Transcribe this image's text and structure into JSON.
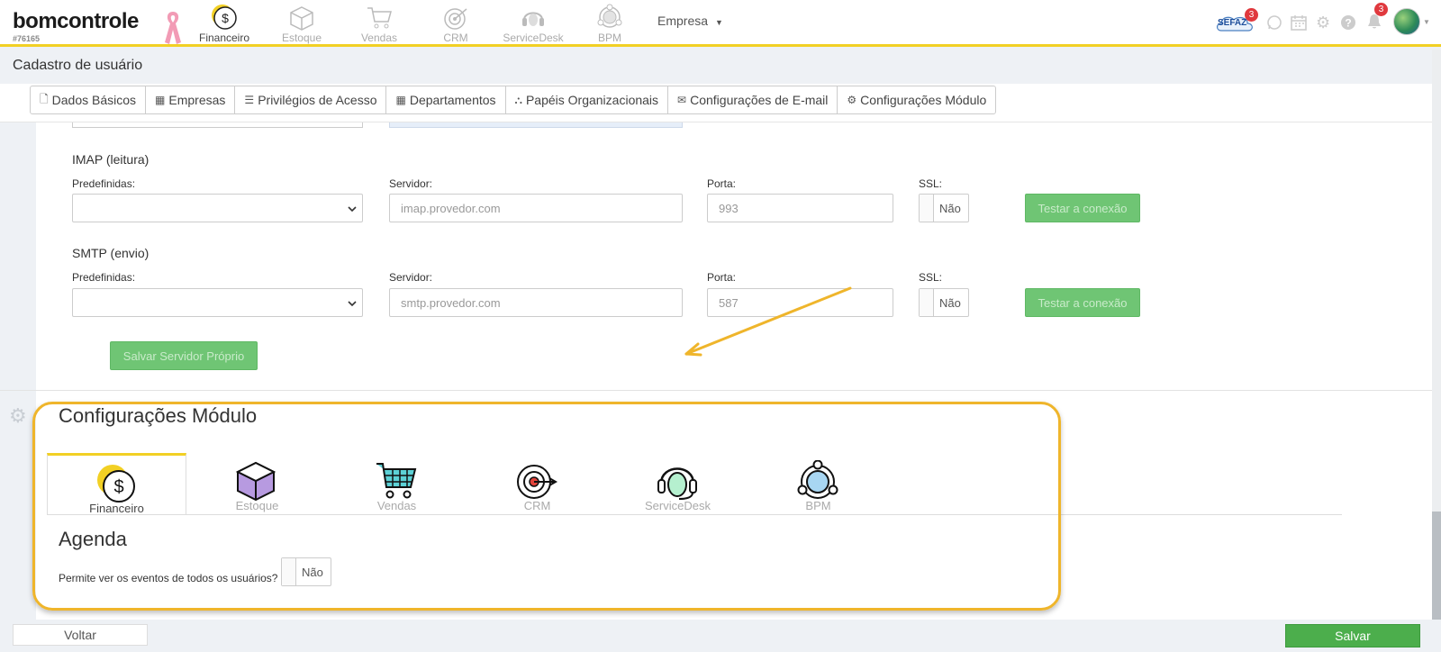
{
  "brand": {
    "name": "bomcontrole",
    "code": "#76165"
  },
  "modules": [
    {
      "label": "Financeiro",
      "icon": "dollar-coin-icon"
    },
    {
      "label": "Estoque",
      "icon": "box-icon"
    },
    {
      "label": "Vendas",
      "icon": "cart-icon"
    },
    {
      "label": "CRM",
      "icon": "target-icon"
    },
    {
      "label": "ServiceDesk",
      "icon": "headset-icon"
    },
    {
      "label": "BPM",
      "icon": "network-icon"
    }
  ],
  "empresa": {
    "label": "Empresa"
  },
  "topRight": {
    "sefaz_label": "SEFAZ",
    "sefaz_badge": "3",
    "bell_badge": "3"
  },
  "page": {
    "title": "Cadastro de usuário"
  },
  "tabs": [
    {
      "label": "Dados Básicos",
      "icon": "file-icon"
    },
    {
      "label": "Empresas",
      "icon": "building-icon"
    },
    {
      "label": "Privilégios de Acesso",
      "icon": "list-icon"
    },
    {
      "label": "Departamentos",
      "icon": "building-icon"
    },
    {
      "label": "Papéis Organizacionais",
      "icon": "sitemap-icon"
    },
    {
      "label": "Configurações de E-mail",
      "icon": "envelope-icon"
    },
    {
      "label": "Configurações Módulo",
      "icon": "gear-icon"
    }
  ],
  "imap": {
    "title": "IMAP (leitura)",
    "predef_label": "Predefinidas:",
    "server_label": "Servidor:",
    "server_placeholder": "imap.provedor.com",
    "port_label": "Porta:",
    "port_placeholder": "993",
    "ssl_label": "SSL:",
    "ssl_value": "Não",
    "test_button": "Testar a conexão"
  },
  "smtp": {
    "title": "SMTP (envio)",
    "predef_label": "Predefinidas:",
    "server_label": "Servidor:",
    "server_placeholder": "smtp.provedor.com",
    "port_label": "Porta:",
    "port_placeholder": "587",
    "ssl_label": "SSL:",
    "ssl_value": "Não",
    "test_button": "Testar a conexão"
  },
  "save_server_button": "Salvar Servidor Próprio",
  "moduleConfig": {
    "title": "Configurações Módulo",
    "tabs": [
      {
        "label": "Financeiro"
      },
      {
        "label": "Estoque"
      },
      {
        "label": "Vendas"
      },
      {
        "label": "CRM"
      },
      {
        "label": "ServiceDesk"
      },
      {
        "label": "BPM"
      }
    ],
    "agenda_title": "Agenda",
    "agenda_question": "Permite ver os eventos de todos os usuários?",
    "agenda_value": "Não"
  },
  "footer": {
    "back": "Voltar",
    "save": "Salvar"
  },
  "colors": {
    "accent": "#f2d024",
    "green": "#4cae4c",
    "highlight": "#efb52b",
    "badge": "#e0393e"
  }
}
